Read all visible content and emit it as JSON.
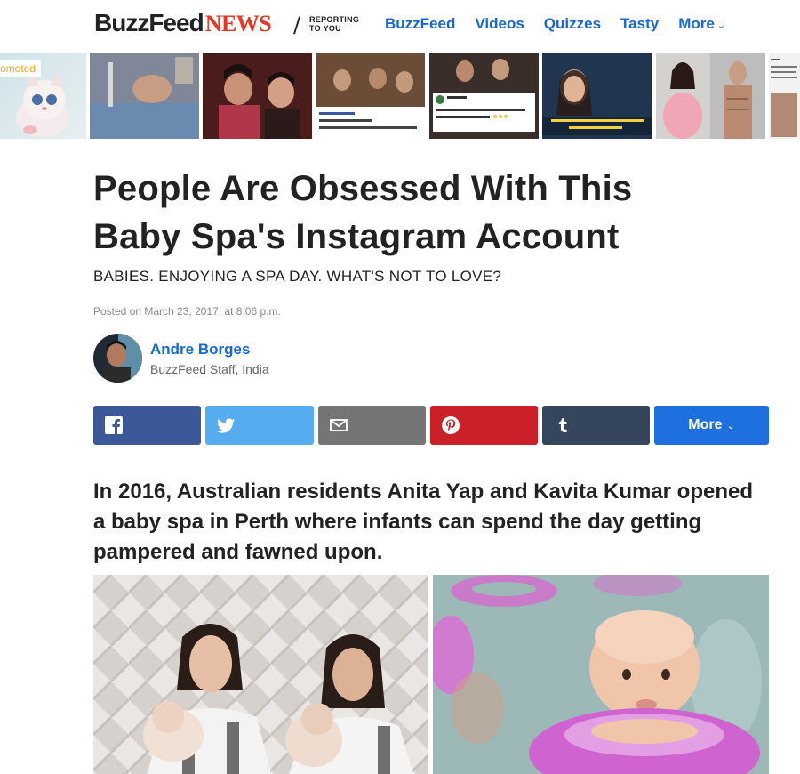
{
  "header": {
    "logo_main": "BuzzFeed",
    "logo_news": "NEWS",
    "reporting_line1": "REPORTING",
    "reporting_line2": "TO YOU",
    "nav": [
      "BuzzFeed",
      "Videos",
      "Quizzes",
      "Tasty",
      "More"
    ]
  },
  "strip": {
    "promoted_label": "omoted"
  },
  "article": {
    "title_line1": "People Are Obsessed With This",
    "title_line2": "Baby Spa's Instagram Account",
    "dek": "BABIES. ENJOYING A SPA DAY. WHAT'S NOT TO LOVE?",
    "posted": "Posted on March 23, 2017, at 8:06 p.m.",
    "author_name": "Andre Borges",
    "author_role": "BuzzFeed Staff, India",
    "lede": "In 2016, Australian residents Anita Yap and Kavita Kumar opened a baby spa in Perth where infants can spend the day getting pampered and fawned upon."
  },
  "share": {
    "more_label": "More",
    "colors": {
      "facebook": "#3b5998",
      "twitter": "#55acee",
      "email": "#757575",
      "pinterest": "#cb2027",
      "tumblr": "#35465c",
      "more": "#1e6fe0"
    }
  },
  "accent": {
    "link_blue": "#1667d9",
    "news_red": "#e32222",
    "promoted_orange": "#f5a623"
  }
}
